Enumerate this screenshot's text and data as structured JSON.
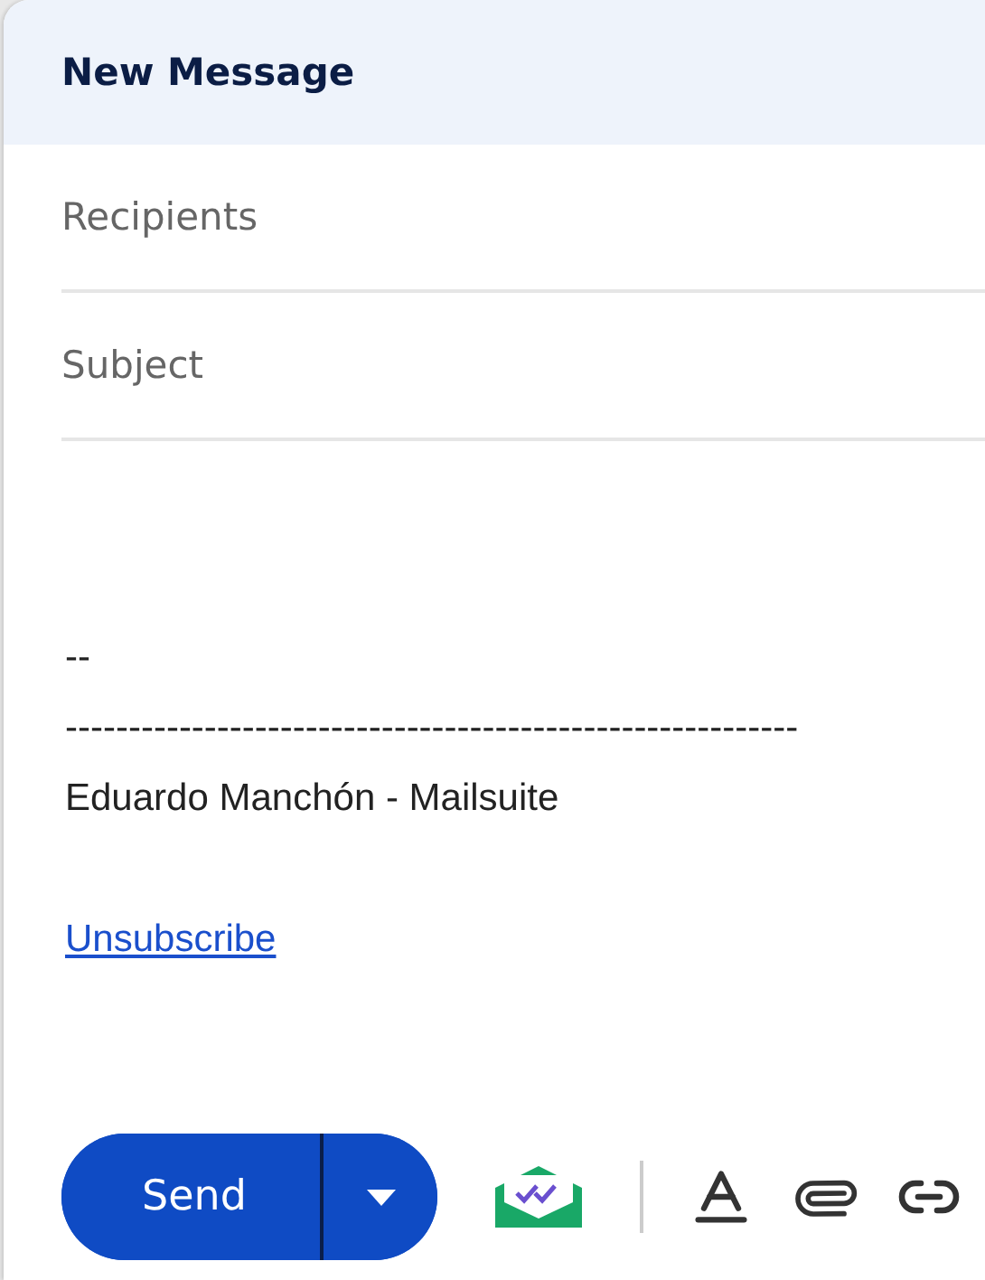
{
  "window": {
    "title": "New Message"
  },
  "fields": [
    {
      "placeholder": "Recipients"
    },
    {
      "placeholder": "Subject"
    }
  ],
  "body": {
    "signature": [
      "--",
      "----------------------------------------------------------",
      "Eduardo Manchón - Mailsuite"
    ],
    "link": "Unsubscribe"
  },
  "send_button": {
    "label": "Send"
  }
}
